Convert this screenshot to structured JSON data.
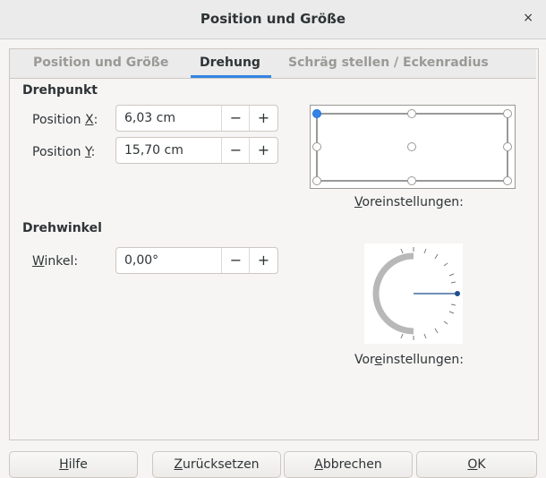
{
  "window": {
    "title": "Position und Größe",
    "close_glyph": "×"
  },
  "tabs": [
    {
      "label": "Position und Größe",
      "active": false
    },
    {
      "label": "Drehung",
      "active": true
    },
    {
      "label": "Schräg stellen / Eckenradius",
      "active": false
    }
  ],
  "pivot": {
    "heading": "Drehpunkt",
    "x_label_pre": "Position ",
    "x_label_mnemonic": "X",
    "x_label_post": ":",
    "x_value": "6,03 cm",
    "y_label_pre": "Position ",
    "y_label_mnemonic": "Y",
    "y_label_post": ":",
    "y_value": "15,70 cm",
    "presets_caption_mnemonic": "V",
    "presets_caption_rest": "oreinstellungen:"
  },
  "angle": {
    "heading": "Drehwinkel",
    "label_mnemonic": "W",
    "label_rest": "inkel:",
    "value": "0,00°",
    "presets_caption_pre": "Vor",
    "presets_caption_mnemonic": "e",
    "presets_caption_rest": "instellungen:"
  },
  "spin": {
    "minus": "−",
    "plus": "+"
  },
  "buttons": {
    "help_mnemonic": "H",
    "help_rest": "ilfe",
    "reset_mnemonic": "Z",
    "reset_rest": "urücksetzen",
    "cancel_mnemonic": "A",
    "cancel_rest": "bbrechen",
    "ok_mnemonic": "O",
    "ok_rest": "K"
  },
  "colors": {
    "accent": "#3584e4",
    "dial_needle": "#1c4e8c"
  }
}
